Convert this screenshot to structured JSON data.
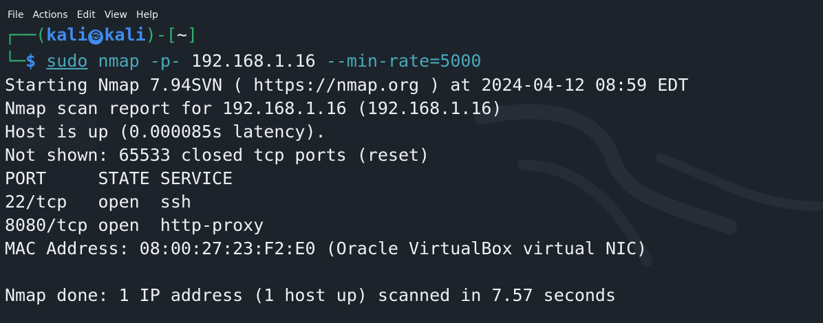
{
  "menu": {
    "items": [
      "File",
      "Actions",
      "Edit",
      "View",
      "Help"
    ]
  },
  "prompt": {
    "open": "┌──(",
    "user": "kali",
    "skull_glyph": "㉿",
    "host": "kali",
    "mid": ")-[",
    "dir": "~",
    "close": "]",
    "corner": "└─",
    "dollar": "$"
  },
  "command": {
    "sudo": "sudo",
    "program": "nmap",
    "flag": "-p-",
    "target": "192.168.1.16",
    "rate": "--min-rate=5000"
  },
  "output": {
    "line1": "Starting Nmap 7.94SVN ( https://nmap.org ) at 2024-04-12 08:59 EDT",
    "line2": "Nmap scan report for 192.168.1.16 (192.168.1.16)",
    "line3": "Host is up (0.000085s latency).",
    "line4": "Not shown: 65533 closed tcp ports (reset)",
    "header": "PORT     STATE SERVICE",
    "row1": "22/tcp   open  ssh",
    "row2": "8080/tcp open  http-proxy",
    "mac": "MAC Address: 08:00:27:23:F2:E0 (Oracle VirtualBox virtual NIC)",
    "done": "Nmap done: 1 IP address (1 host up) scanned in 7.57 seconds"
  },
  "colors": {
    "background": "#1d232b",
    "text": "#eef0f2",
    "prompt_green": "#2fb36d",
    "prompt_blue": "#3f8cf0",
    "command_teal": "#48a9b9"
  }
}
